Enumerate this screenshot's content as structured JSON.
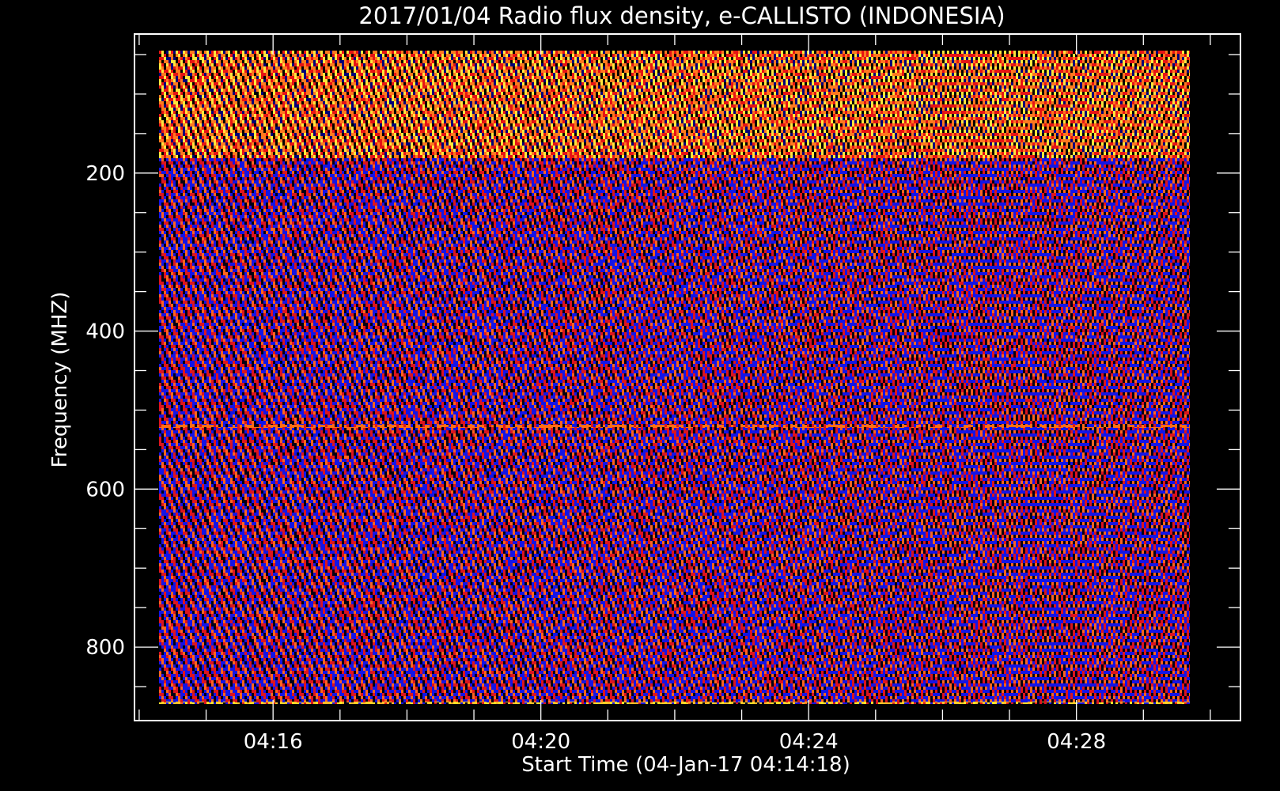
{
  "chart_data": {
    "type": "heatmap",
    "title": "2017/01/04  Radio flux density, e-CALLISTO (INDONESIA)",
    "xlabel": "Start Time (04-Jan-17 04:14:18)",
    "ylabel": "Frequency (MHZ)",
    "x_tick_labels": [
      "04:16",
      "04:20",
      "04:24",
      "04:28"
    ],
    "x_tick_minutes": [
      16,
      20,
      24,
      28
    ],
    "x_minor_tick_step_minutes": 1,
    "xlim_minutes_after_0400": [
      13.93,
      30.45
    ],
    "data_time_range_minutes_after_0400": [
      14.3,
      29.7
    ],
    "y_tick_labels": [
      "200",
      "400",
      "600",
      "800"
    ],
    "y_tick_values": [
      200,
      400,
      600,
      800
    ],
    "y_minor_tick_step": 50,
    "ylim": [
      24,
      893
    ],
    "y_inverted": true,
    "data_freq_range_mhz": [
      45,
      872
    ],
    "colormap": [
      "#000000",
      "#1010ff",
      "#ff1010",
      "#ff8020",
      "#ffff40"
    ],
    "features": {
      "hot_band_mhz": [
        45,
        180
      ],
      "interference_line_mhz": 520,
      "pattern": "diagonal periodic stripes drifting to higher frequency over time"
    }
  }
}
